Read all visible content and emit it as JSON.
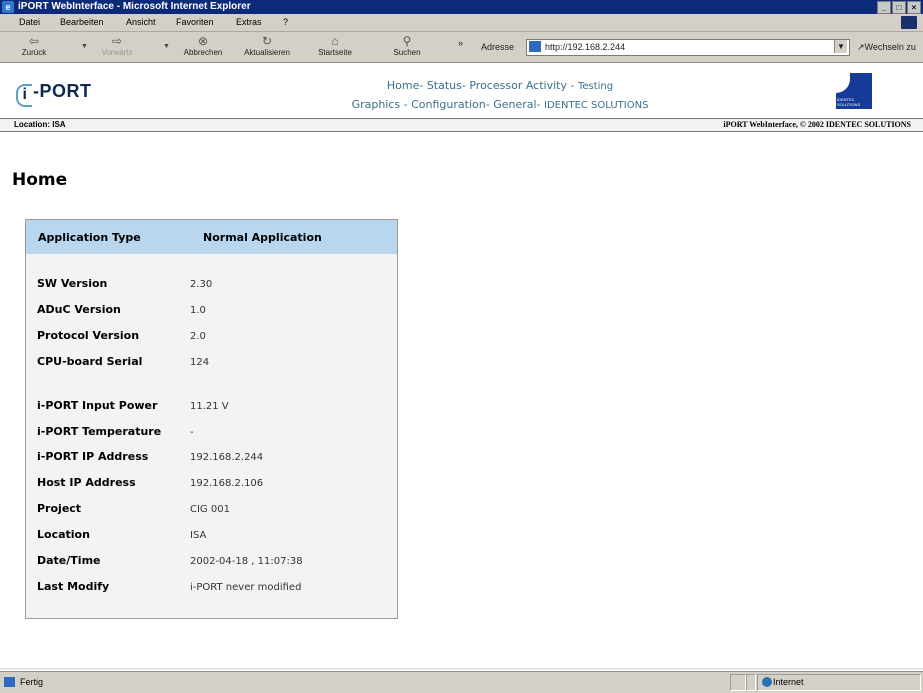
{
  "window": {
    "title": "iPORT WebInterface - Microsoft Internet Explorer"
  },
  "menu": {
    "items": [
      "Datei",
      "Bearbeiten",
      "Ansicht",
      "Favoriten",
      "Extras",
      "?"
    ]
  },
  "toolbar": {
    "back": "Zurück",
    "forward": "Vorwärts",
    "stop": "Abbrechen",
    "refresh": "Aktualisieren",
    "home": "Startseite",
    "search": "Suchen",
    "more": "»",
    "address_label": "Adresse",
    "address_url": "http://192.168.2.244",
    "go_label": "Wechseln zu"
  },
  "banner": {
    "logo_text": "-PORT",
    "logo_i": "i",
    "nav_line1": [
      "Home",
      "Status",
      "Processor Activity",
      "Testing"
    ],
    "nav_line2": [
      "Graphics",
      "Configuration",
      "General",
      "IDENTEC SOLUTIONS"
    ],
    "id_logo_text": "IDENTEC SOLUTIONS"
  },
  "location_bar": {
    "location": "Location: ISA",
    "copyright": "iPORT WebInterface, © 2002 IDENTEC SOLUTIONS"
  },
  "page": {
    "title": "Home",
    "header_key": "Application Type",
    "header_value": "Normal Application",
    "rows": [
      {
        "key": "SW Version",
        "value": "2.30"
      },
      {
        "key": "ADuC Version",
        "value": "1.0"
      },
      {
        "key": "Protocol Version",
        "value": "2.0"
      },
      {
        "key": "CPU-board Serial",
        "value": "124"
      },
      {
        "key": "i-PORT Input Power",
        "value": "11.21 V"
      },
      {
        "key": "i-PORT Temperature",
        "value": "-"
      },
      {
        "key": "i-PORT IP Address",
        "value": "192.168.2.244"
      },
      {
        "key": "Host IP Address",
        "value": "192.168.2.106"
      },
      {
        "key": "Project",
        "value": "CIG 001"
      },
      {
        "key": "Location",
        "value": "ISA"
      },
      {
        "key": "Date/Time",
        "value": "2002-04-18 , 11:07:38"
      },
      {
        "key": "Last Modify",
        "value": "i-PORT never modified"
      }
    ]
  },
  "status": {
    "text": "Fertig",
    "zone": "Internet"
  },
  "colors": {
    "titlebar": "#0b2a7a",
    "header_band": "#b8d6ee",
    "nav_text": "#3a6f8c"
  }
}
